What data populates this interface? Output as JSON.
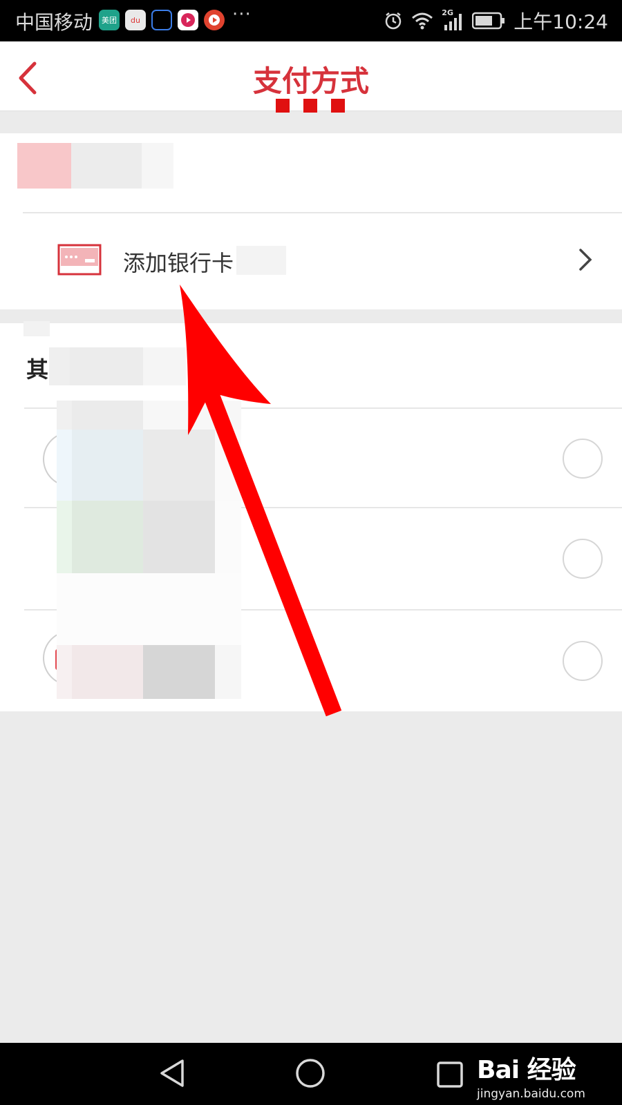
{
  "status_bar": {
    "carrier": "中国移动",
    "app_icons": [
      {
        "name": "meituan-icon",
        "label": "美团",
        "color": "#1fa28a"
      },
      {
        "name": "baidu-map-icon",
        "label": "du",
        "color": "#e8e8e8"
      },
      {
        "name": "qq-notify-icon",
        "label": "",
        "color": "#000000"
      },
      {
        "name": "video-app-icon",
        "label": "",
        "color": "#ffffff"
      },
      {
        "name": "play-app-icon",
        "label": "",
        "color": "#e0432f"
      }
    ],
    "more": "···",
    "network": "2G",
    "time": "上午10:24"
  },
  "header": {
    "title": "支付方式"
  },
  "add_card": {
    "label": "添加银行卡"
  },
  "other_section": {
    "title": "其"
  },
  "watermark": {
    "logo": "Bai 经验",
    "url": "jingyan.baidu.com"
  },
  "colors": {
    "accent": "#d6323b",
    "annotation_arrow": "#ff0000"
  }
}
